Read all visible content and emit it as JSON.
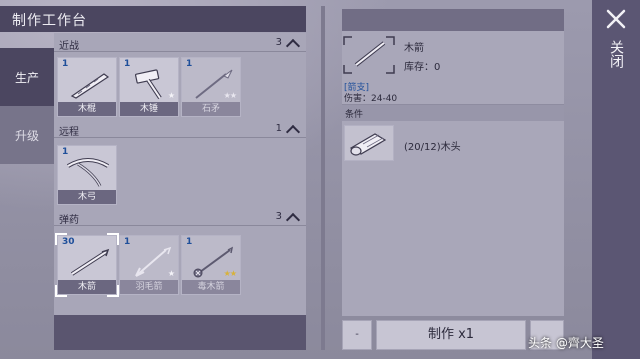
{
  "title": "制作工作台",
  "tabs": [
    {
      "label": "生产",
      "active": true
    },
    {
      "label": "升级",
      "active": false
    }
  ],
  "categories": [
    {
      "name": "近战",
      "count": "3",
      "items": [
        {
          "qty": "1",
          "name": "木棍",
          "stars": "",
          "icon": "wooden-stick-icon"
        },
        {
          "qty": "1",
          "name": "木锤",
          "stars": "★",
          "icon": "wooden-hammer-icon"
        },
        {
          "qty": "1",
          "name": "石矛",
          "stars": "★★",
          "icon": "stone-spear-icon"
        }
      ]
    },
    {
      "name": "远程",
      "count": "1",
      "items": [
        {
          "qty": "1",
          "name": "木弓",
          "stars": "",
          "icon": "wooden-bow-icon"
        }
      ]
    },
    {
      "name": "弹药",
      "count": "3",
      "items": [
        {
          "qty": "30",
          "name": "木箭",
          "stars": "",
          "icon": "wooden-arrow-icon"
        },
        {
          "qty": "1",
          "name": "羽毛箭",
          "stars": "★",
          "icon": "feather-arrow-icon"
        },
        {
          "qty": "1",
          "name": "毒木箭",
          "stars": "★★",
          "icon": "poison-arrow-icon"
        }
      ]
    }
  ],
  "detail": {
    "name": "木箭",
    "stock": "库存：0",
    "type": "[箭支]",
    "damage": "伤害：24-40",
    "conditions_label": "条件",
    "condition": {
      "text": "(20/12)木头",
      "icon": "wood-log-icon"
    }
  },
  "buttons": {
    "minus": "-",
    "craft": "制作 x1",
    "close": "关闭"
  },
  "watermark": "头条 @齊大圣",
  "colors": {
    "panel_dark": "#4b4660",
    "panel_light": "#a8a6b8",
    "quantity_blue": "#1f4f9a",
    "star_gold": "#d8b23a"
  }
}
